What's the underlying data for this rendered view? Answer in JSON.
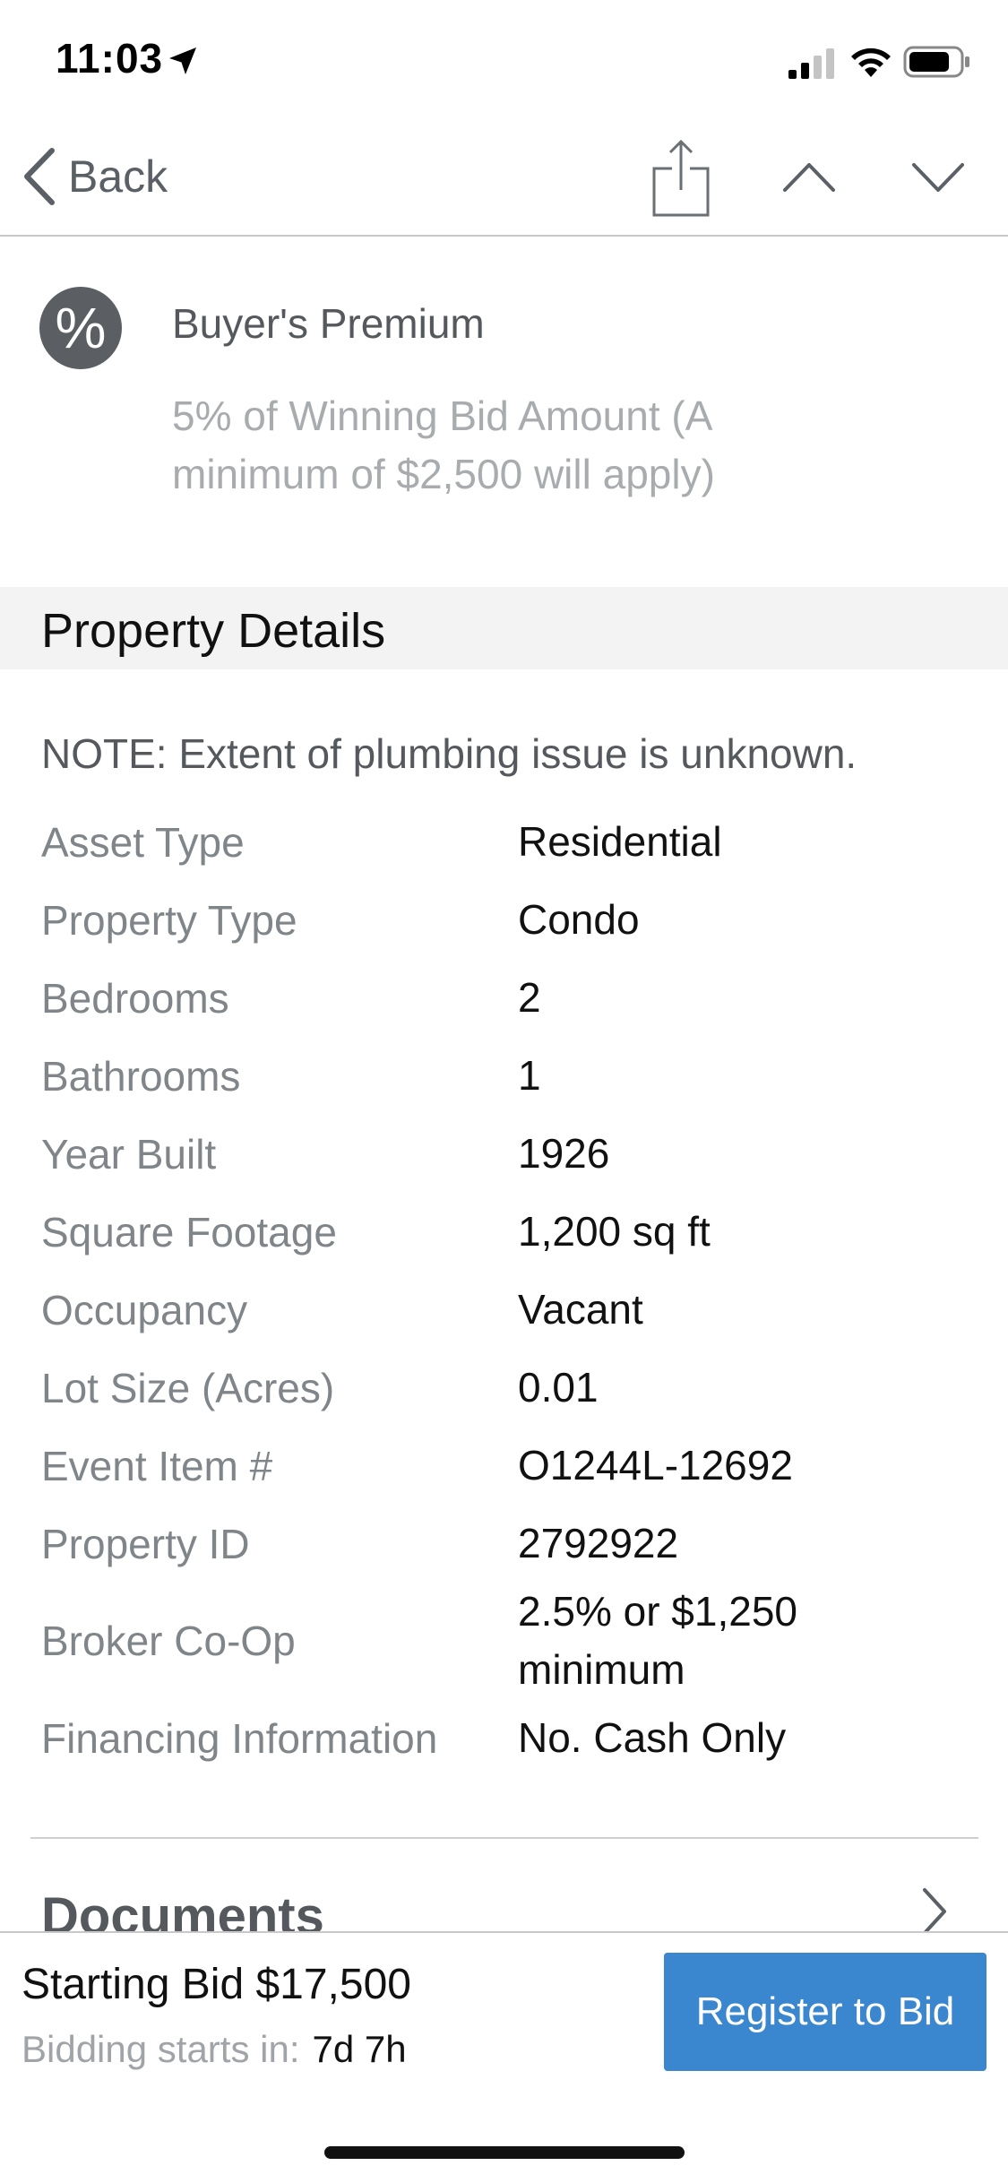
{
  "status_bar": {
    "time": "11:03"
  },
  "nav": {
    "back_label": "Back"
  },
  "buyer_premium": {
    "icon_glyph": "%",
    "title": "Buyer's Premium",
    "description": "5% of Winning Bid Amount (A minimum of $2,500 will apply)"
  },
  "property_details": {
    "title": "Property Details",
    "note": "NOTE: Extent of plumbing issue is unknown.",
    "rows": [
      {
        "label": "Asset Type",
        "value": "Residential"
      },
      {
        "label": "Property Type",
        "value": "Condo"
      },
      {
        "label": "Bedrooms",
        "value": "2"
      },
      {
        "label": "Bathrooms",
        "value": "1"
      },
      {
        "label": "Year Built",
        "value": "1926"
      },
      {
        "label": "Square Footage",
        "value": "1,200 sq ft"
      },
      {
        "label": "Occupancy",
        "value": "Vacant"
      },
      {
        "label": "Lot Size (Acres)",
        "value": "0.01"
      },
      {
        "label": "Event Item #",
        "value": "O1244L-12692"
      },
      {
        "label": "Property ID",
        "value": "2792922"
      },
      {
        "label": "Broker Co-Op",
        "value": "2.5% or $1,250 minimum"
      },
      {
        "label": "Financing Information",
        "value": "No. Cash Only"
      }
    ]
  },
  "documents": {
    "title": "Documents"
  },
  "footer": {
    "starting_bid": "Starting Bid $17,500",
    "bidding_starts_label": "Bidding starts in:",
    "bidding_starts_value": "7d 7h",
    "register_label": "Register to Bid"
  },
  "colors": {
    "accent": "#3a86cf",
    "icon_bg": "#5b5f63",
    "section_bg": "#f3f3f3"
  }
}
